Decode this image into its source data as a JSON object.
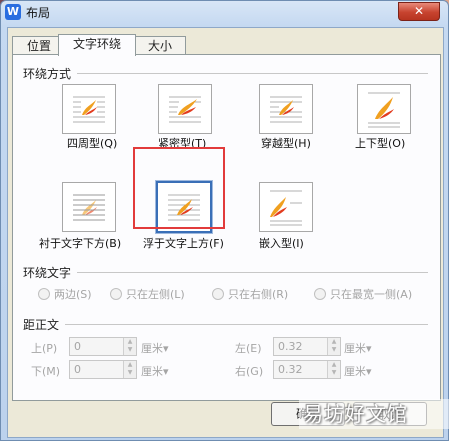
{
  "window": {
    "title": "布局",
    "icon_glyph": "W",
    "close_glyph": "✕"
  },
  "tabs": [
    {
      "label": "位置",
      "active": false
    },
    {
      "label": "文字环绕",
      "active": true
    },
    {
      "label": "大小",
      "active": false
    }
  ],
  "wrap_style": {
    "section_label": "环绕方式",
    "options": [
      {
        "label": "四周型(Q)",
        "icon": "wrap-square-icon"
      },
      {
        "label": "紧密型(T)",
        "icon": "wrap-tight-icon"
      },
      {
        "label": "穿越型(H)",
        "icon": "wrap-through-icon"
      },
      {
        "label": "上下型(O)",
        "icon": "wrap-top-bottom-icon"
      },
      {
        "label": "衬于文字下方(B)",
        "icon": "wrap-behind-text-icon"
      },
      {
        "label": "浮于文字上方(F)",
        "icon": "wrap-in-front-icon",
        "selected": true
      },
      {
        "label": "嵌入型(I)",
        "icon": "wrap-inline-icon"
      }
    ]
  },
  "wrap_text": {
    "section_label": "环绕文字",
    "options": [
      {
        "label": "两边(S)"
      },
      {
        "label": "只在左侧(L)"
      },
      {
        "label": "只在右侧(R)"
      },
      {
        "label": "只在最宽一侧(A)"
      }
    ]
  },
  "distance": {
    "section_label": "距正文",
    "top": {
      "label": "上(P)",
      "value": "0",
      "unit": "厘米▾"
    },
    "bottom": {
      "label": "下(M)",
      "value": "0",
      "unit": "厘米▾"
    },
    "left": {
      "label": "左(E)",
      "value": "0.32",
      "unit": "厘米▾"
    },
    "right": {
      "label": "右(G)",
      "value": "0.32",
      "unit": "厘米▾"
    }
  },
  "buttons": {
    "ok": "确定",
    "cancel": "取消"
  },
  "watermark": "易坊好文馆",
  "colors": {
    "highlight_box": "#e23b3b",
    "selected_border": "#3a6fb7",
    "icon_flame": "#f0a020",
    "icon_lines": "#b0b0b0"
  }
}
